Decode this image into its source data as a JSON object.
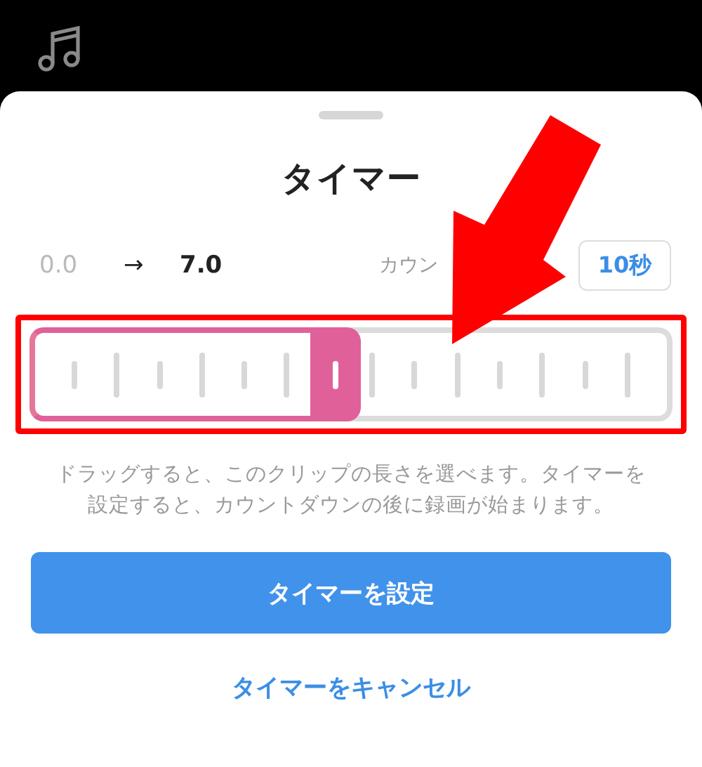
{
  "sheet": {
    "title": "タイマー",
    "range": {
      "start": "0.0",
      "arrow": "→",
      "end": "7.0"
    },
    "countdown_label": "カウン",
    "countdown_button": "10秒",
    "hint": "ドラッグすると、このクリップの長さを選べます。タイマーを設定すると、カウントダウンの後に録画が始まります。",
    "primary_button": "タイマーを設定",
    "cancel_link": "タイマーをキャンセル"
  }
}
